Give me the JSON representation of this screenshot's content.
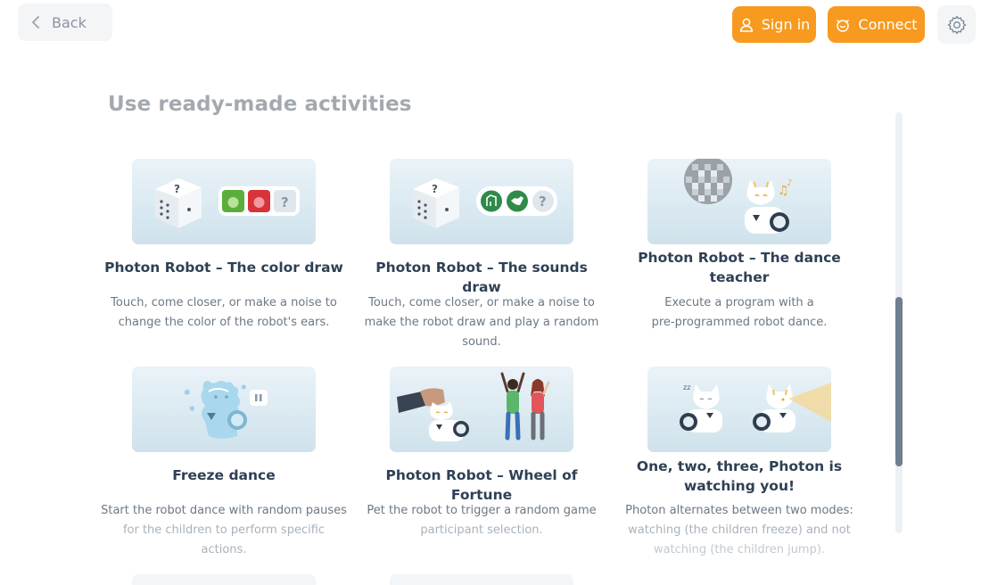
{
  "header": {
    "back_label": "Back",
    "sign_in_label": "Sign in",
    "connect_label": "Connect",
    "accent_color": "#f79a1f"
  },
  "section": {
    "title": "Use ready-made activities"
  },
  "activities": [
    {
      "title": "Photon Robot – The color draw",
      "description_lines": [
        "Touch, come closer, or make a noise to",
        "change the color of the robot's ears."
      ],
      "image_icon": "dice-color-icon"
    },
    {
      "title": "Photon Robot – The sounds draw",
      "description_lines": [
        "Touch, come closer, or make a noise to",
        "make the robot draw and play a random",
        "sound."
      ],
      "image_icon": "dice-sound-icon"
    },
    {
      "title_lines": [
        "Photon Robot – The dance",
        "teacher"
      ],
      "description_lines": [
        "Execute a program with a",
        "pre-programmed robot dance."
      ],
      "image_icon": "disco-robot-icon"
    },
    {
      "title": "Freeze dance",
      "description_lines": [
        "Start the robot dance with random pauses",
        "for the children to perform specific actions."
      ],
      "image_icon": "frozen-robot-icon"
    },
    {
      "title": "Photon Robot – Wheel of Fortune",
      "description_lines": [
        "Pet the robot to trigger a random game",
        "participant selection."
      ],
      "image_icon": "children-robot-icon"
    },
    {
      "title_lines": [
        "One, two, three, Photon is",
        "watching you!"
      ],
      "description_lines": [
        "Photon alternates between two modes:",
        "watching (the children freeze) and not",
        "watching (the children jump)."
      ],
      "image_icon": "watching-robot-icon"
    }
  ]
}
